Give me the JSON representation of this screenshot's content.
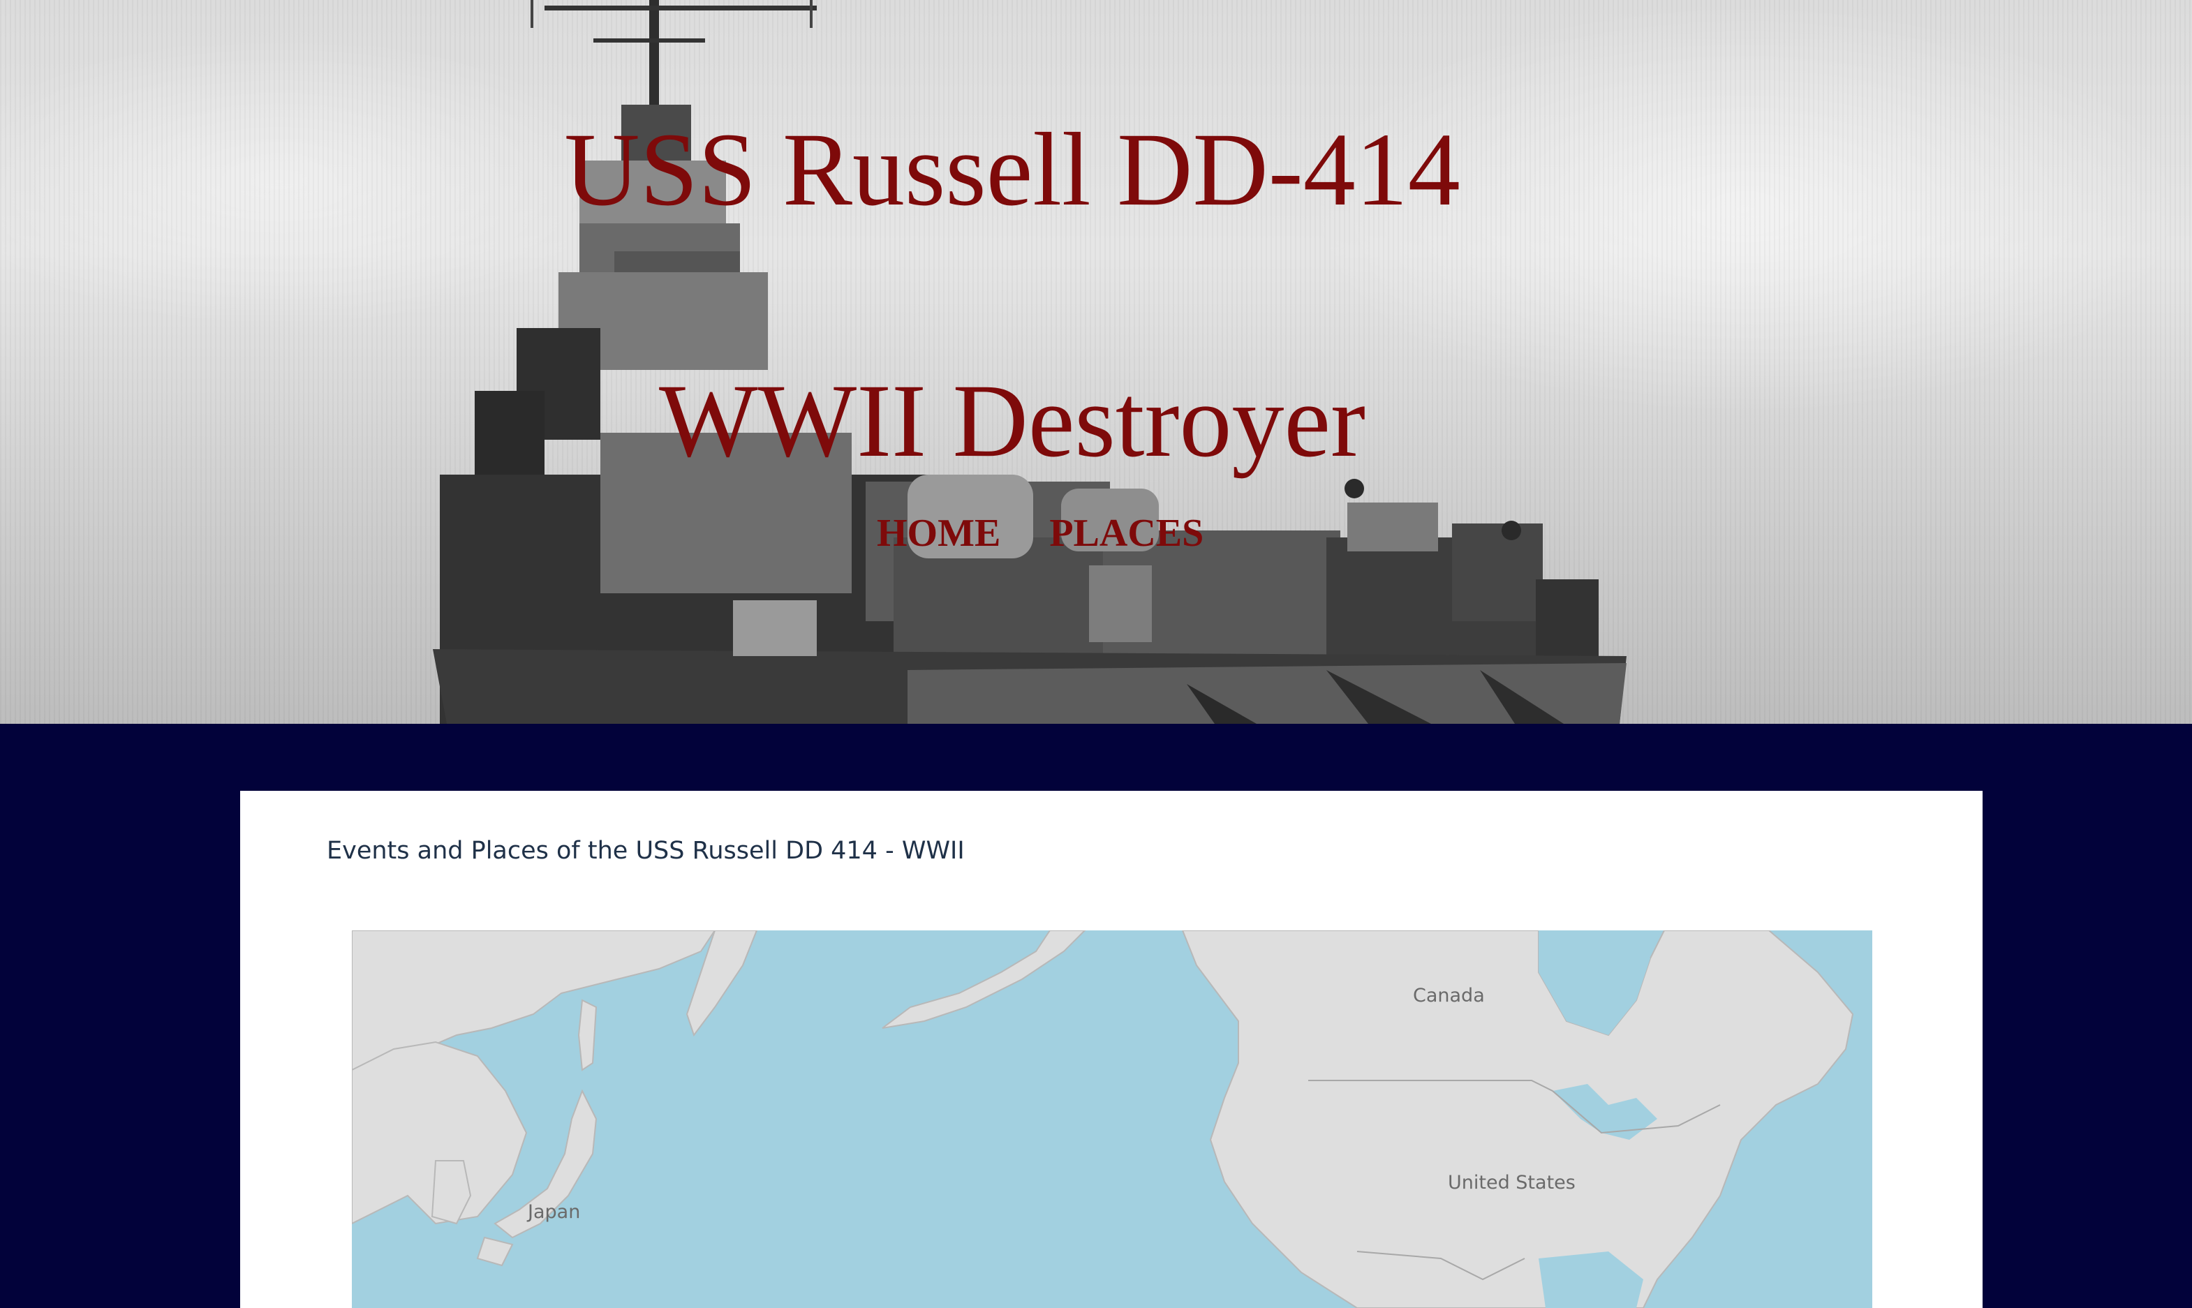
{
  "header": {
    "title_line1": "USS Russell DD-414",
    "title_line2": "WWII Destroyer",
    "nav": [
      {
        "label": "HOME"
      },
      {
        "label": "PLACES"
      }
    ]
  },
  "content": {
    "heading": "Events and Places of the USS Russell DD 414 - WWII",
    "map": {
      "labels": [
        "Canada",
        "United States",
        "Japan"
      ]
    }
  },
  "colors": {
    "title": "#7e0a0a",
    "page_background": "#02023a",
    "ocean": "#a2d0e0",
    "land": "#dedede"
  }
}
